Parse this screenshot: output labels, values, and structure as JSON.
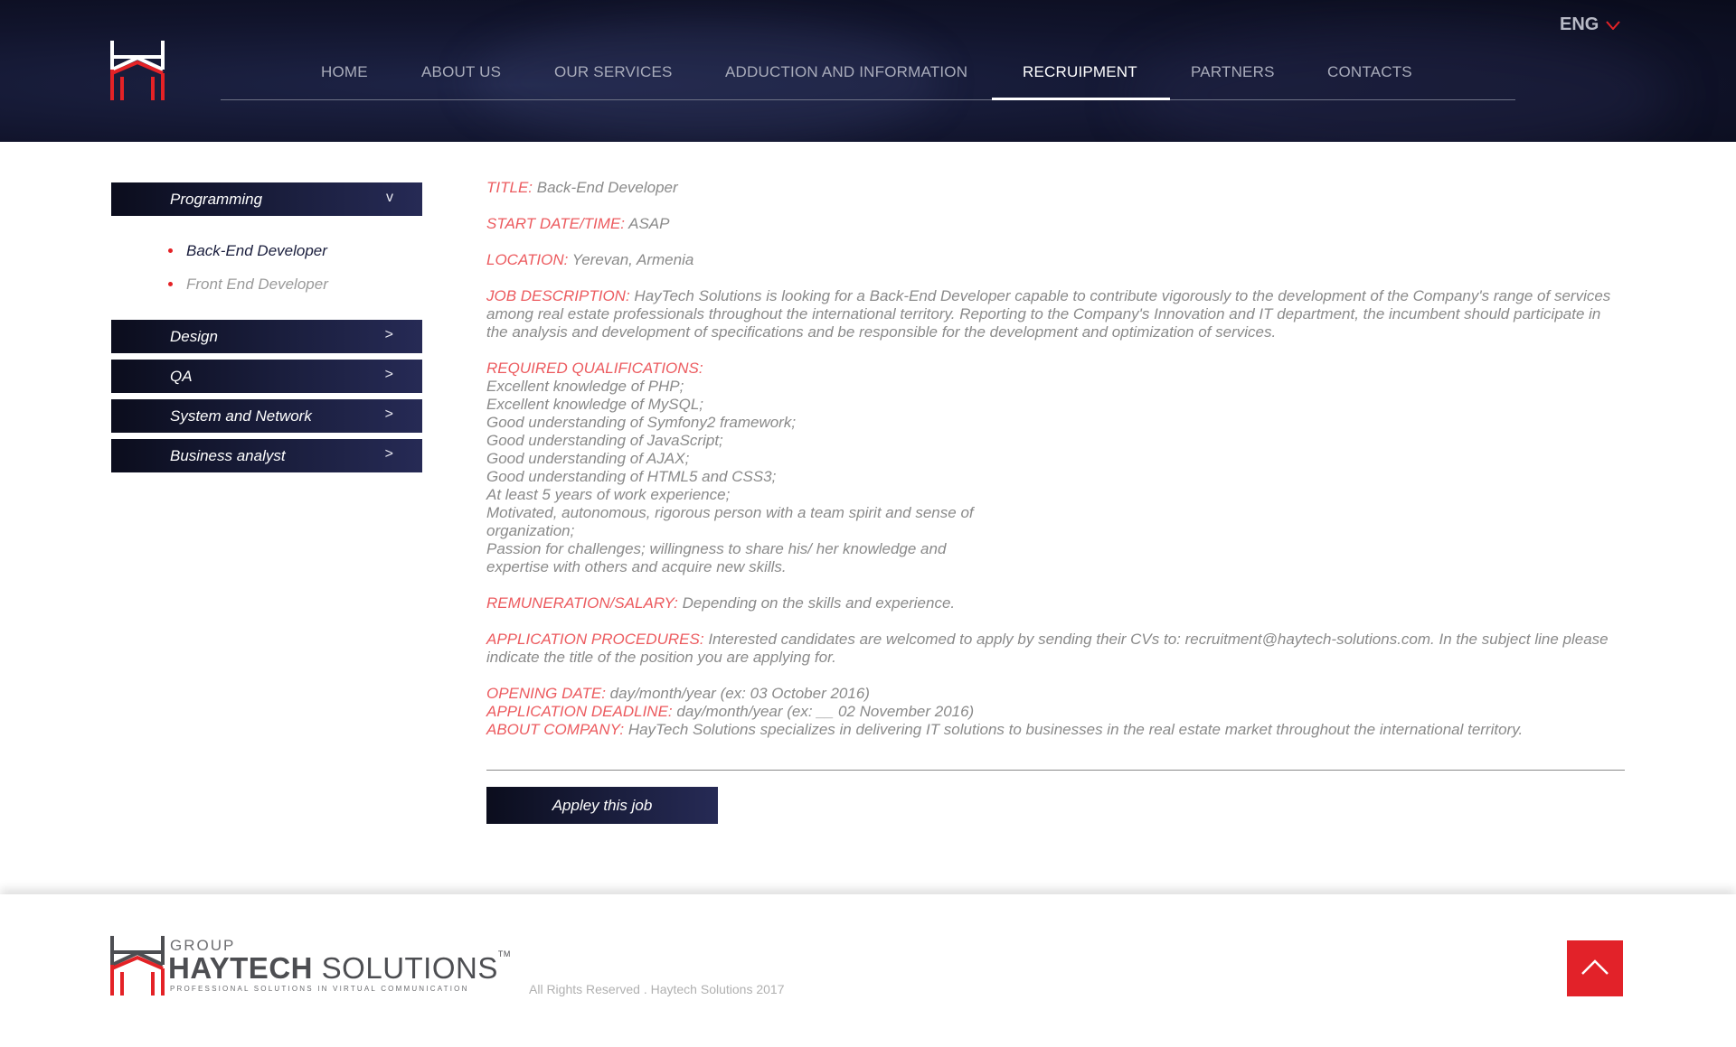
{
  "header": {
    "language": "ENG",
    "nav": [
      {
        "label": "HOME"
      },
      {
        "label": "ABOUT US"
      },
      {
        "label": "OUR SERVICES"
      },
      {
        "label": "ADDUCTION AND INFORMATION"
      },
      {
        "label": "RECRUIPMENT",
        "active": true
      },
      {
        "label": "PARTNERS"
      },
      {
        "label": "CONTACTS"
      }
    ]
  },
  "sidebar": {
    "categories": [
      {
        "label": "Programming",
        "expanded": true,
        "items": [
          "Back-End Developer",
          "Front End Developer"
        ]
      },
      {
        "label": "Design"
      },
      {
        "label": "QA"
      },
      {
        "label": "System and Network"
      },
      {
        "label": "Business analyst"
      }
    ],
    "expand_symbol": "v",
    "collapse_symbol": ">"
  },
  "job": {
    "title_label": "TITLE:",
    "title": "Back-End Developer",
    "start_label": "START DATE/TIME:",
    "start": "ASAP",
    "location_label": "LOCATION:",
    "location": "Yerevan, Armenia",
    "description_label": "JOB DESCRIPTION:",
    "description": "HayTech Solutions is looking for a Back-End Developer capable to contribute vigorously to the development of the Company's range of services among real estate professionals throughout the international territory. Reporting to the Company's Innovation and IT department, the incumbent should participate in the analysis and development of specifications and be responsible for the development and optimization of services.",
    "qualifications_label": "REQUIRED QUALIFICATIONS:",
    "qualifications": [
      "Excellent knowledge of PHP;",
      "Excellent knowledge of MySQL;",
      "Good understanding of Symfony2 framework;",
      "Good understanding of JavaScript;",
      "Good understanding of AJAX;",
      "Good understanding of HTML5 and CSS3;",
      "At least 5 years of work experience;",
      "Motivated, autonomous, rigorous person with a team spirit and sense of",
      "organization;",
      "Passion for challenges; willingness to share his/ her knowledge and",
      "expertise with others and acquire new skills."
    ],
    "salary_label": "REMUNERATION/SALARY:",
    "salary": "Depending on the skills and experience.",
    "procedures_label": "APPLICATION PROCEDURES:",
    "procedures": "Interested candidates are welcomed to apply by sending their CVs to: recruitment@haytech-solutions.com. In the subject line please indicate the title of the position you are applying for.",
    "opening_label": "OPENING DATE:",
    "opening": "day/month/year (ex: 03 October 2016)",
    "deadline_label": "APPLICATION DEADLINE:",
    "deadline": "day/month/year  (ex: __ 02 November 2016)",
    "about_label": "ABOUT COMPANY:",
    "about": "HayTech Solutions specializes in delivering IT solutions to businesses in the real estate market throughout the international territory.",
    "apply_label": "Appley this job"
  },
  "footer": {
    "logo_group": "GROUP",
    "logo_brand_bold": "HAYTECH",
    "logo_brand_light": "SOLUTIONS",
    "logo_tm": "TM",
    "logo_tagline": "PROFESSIONAL SOLUTIONS IN VIRTUAL COMMUNICATION",
    "rights": "All Rights Reserved . Haytech Solutions 2017"
  },
  "colors": {
    "accent": "#e42226",
    "label_red": "#ec5b5f",
    "header_dark": "#11142c",
    "button_dark": "#1a1e3d",
    "text_gray": "#8a8a8a"
  },
  "icons": [
    "logo-icon",
    "chevron-down-icon",
    "chevron-right-icon",
    "arrow-up-icon"
  ]
}
